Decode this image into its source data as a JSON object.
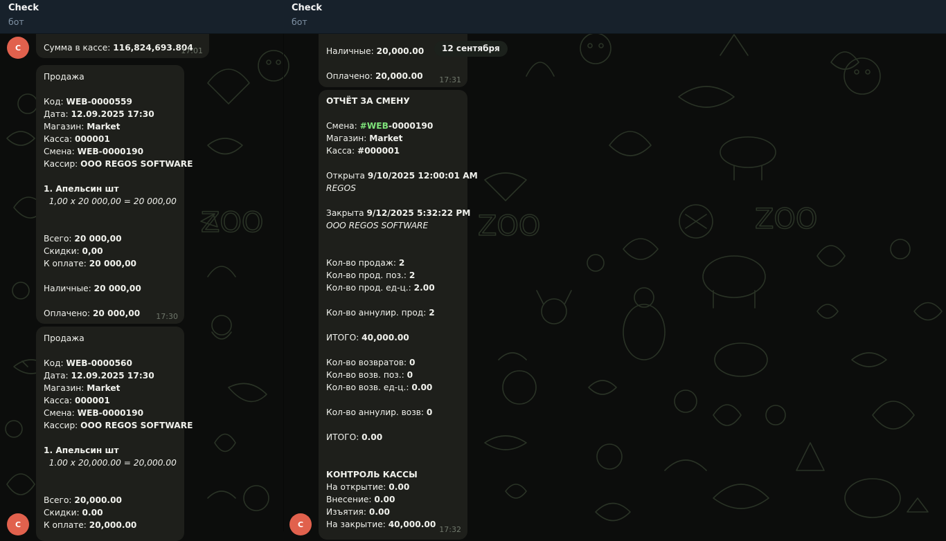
{
  "left_chat": {
    "title": "Check",
    "subtitle": "бот",
    "avatar_letter": "C",
    "msg0": {
      "label": "Сумма в кассе:",
      "value": "116,824,693.804",
      "time": "17:01"
    },
    "msg1": {
      "time": "17:30",
      "heading": "Продажа",
      "code_label": "Код:",
      "code": "WEB-0000559",
      "date_label": "Дата:",
      "date": "12.09.2025 17:30",
      "shop_label": "Магазин:",
      "shop": "Market",
      "register_label": "Касса:",
      "register": "000001",
      "shift_label": "Смена:",
      "shift": "WEB-0000190",
      "cashier_label": "Кассир:",
      "cashier": "OOO REGOS SOFTWARE",
      "item": "1. Апельсин шт",
      "item_calc": "1,00 x 20 000,00 = 20 000,00",
      "total_label": "Всего:",
      "total": "20 000,00",
      "discount_label": "Скидки:",
      "discount": "0,00",
      "to_pay_label": "К оплате:",
      "to_pay": "20 000,00",
      "cash_label": "Наличные:",
      "cash": "20 000,00",
      "paid_label": "Оплачено:",
      "paid": "20 000,00"
    },
    "msg2": {
      "heading": "Продажа",
      "code_label": "Код:",
      "code": "WEB-0000560",
      "date_label": "Дата:",
      "date": "12.09.2025 17:30",
      "shop_label": "Магазин:",
      "shop": "Market",
      "register_label": "Касса:",
      "register": "000001",
      "shift_label": "Смена:",
      "shift": "WEB-0000190",
      "cashier_label": "Кассир:",
      "cashier": "OOO REGOS SOFTWARE",
      "item": "1. Апельсин шт",
      "item_calc": "1.00 x 20,000.00 = 20,000.00",
      "total_label": "Всего:",
      "total": "20,000.00",
      "discount_label": "Скидки:",
      "discount": "0.00",
      "to_pay_label": "К оплате:",
      "to_pay": "20,000.00"
    }
  },
  "right_chat": {
    "title": "Check",
    "subtitle": "бот",
    "avatar_letter": "C",
    "date_chip": "12 сентября",
    "msg0": {
      "cash_label": "Наличные:",
      "cash": "20,000.00",
      "paid_label": "Оплачено:",
      "paid": "20,000.00",
      "time": "17:31"
    },
    "report": {
      "time": "17:32",
      "heading": "ОТЧЁТ ЗА СМЕНУ",
      "shift_label": "Смена:",
      "shift_tag": "#WEB",
      "shift_rest": "-0000190",
      "shop_label": "Магазин:",
      "shop": "Market",
      "register_label": "Касса:",
      "register": "#000001",
      "opened_label": "Открыта",
      "opened": "9/10/2025 12:00:01 AM",
      "opened_by": "REGOS",
      "closed_label": "Закрыта",
      "closed": "9/12/2025 5:32:22 PM",
      "closed_by": "OOO REGOS SOFTWARE",
      "sales_count_label": "Кол-во продаж:",
      "sales_count": "2",
      "sales_pos_label": "Кол-во прод. поз.:",
      "sales_pos": "2",
      "sales_units_label": "Кол-во прод. ед-ц.:",
      "sales_units": "2.00",
      "sales_void_label": "Кол-во аннулир. прод:",
      "sales_void": "2",
      "total1_label": "ИТОГО:",
      "total1": "40,000.00",
      "returns_label": "Кол-во возвратов:",
      "returns": "0",
      "returns_pos_label": "Кол-во возв. поз.:",
      "returns_pos": "0",
      "returns_units_label": "Кол-во возв. ед-ц.:",
      "returns_units": "0.00",
      "returns_void_label": "Кол-во аннулир. возв:",
      "returns_void": "0",
      "total2_label": "ИТОГО:",
      "total2": "0.00",
      "control_heading": "КОНТРОЛЬ КАССЫ",
      "open_cash_label": "На открытие:",
      "open_cash": "0.00",
      "deposit_label": "Внесение:",
      "deposit": "0.00",
      "withdraw_label": "Изъятия:",
      "withdraw": "0.00",
      "close_cash_label": "На закрытие:",
      "close_cash": "40,000.00"
    }
  },
  "colors": {
    "header_bg": "#17212b",
    "bubble_bg": "#1e1f1b",
    "avatar_bg": "#e1614d",
    "hashtag": "#7ee37a"
  }
}
